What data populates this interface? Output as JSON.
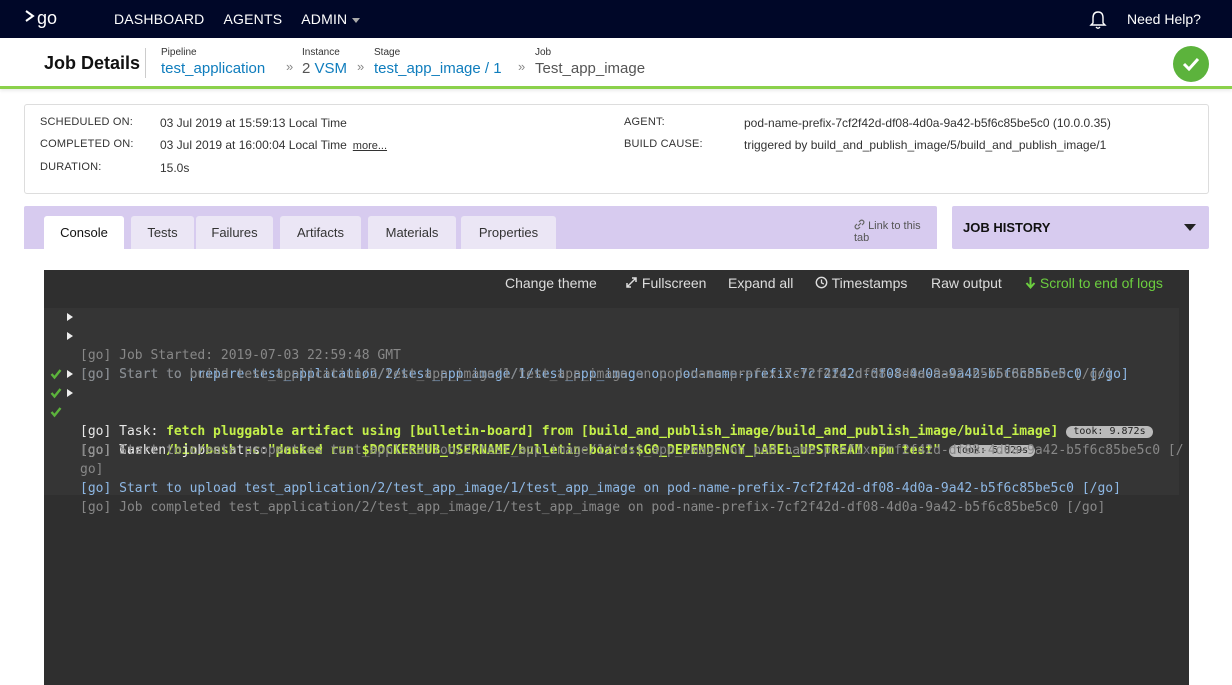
{
  "nav": {
    "logo_text": "go",
    "items": [
      "DASHBOARD",
      "AGENTS",
      "ADMIN"
    ],
    "help": "Need Help?",
    "background": "#000728"
  },
  "header": {
    "title": "Job Details",
    "pipeline_label": "Pipeline",
    "pipeline": "test_application",
    "instance_label": "Instance",
    "instance_num": "2",
    "instance_name": "VSM",
    "stage_label": "Stage",
    "stage": "test_app_image / 1",
    "job_label": "Job",
    "job": "Test_app_image",
    "status_icon": "check-icon",
    "status_color": "#5cb33c"
  },
  "info": {
    "scheduled_label": "SCHEDULED ON:",
    "scheduled": "03 Jul 2019 at 15:59:13 Local Time",
    "completed_label": "COMPLETED ON:",
    "completed": "03 Jul 2019 at 16:00:04 Local Time",
    "more": "more...",
    "duration_label": "DURATION:",
    "duration": "15.0s",
    "agent_label": "AGENT:",
    "agent": "pod-name-prefix-7cf2f42d-df08-4d0a-9a42-b5f6c85be5c0 (10.0.0.35)",
    "cause_label": "BUILD CAUSE:",
    "cause": "triggered by build_and_publish_image/5/build_and_publish_image/1"
  },
  "tabs": {
    "items": [
      "Console",
      "Tests",
      "Failures",
      "Artifacts",
      "Materials",
      "Properties"
    ],
    "active": "Console",
    "link": "Link to this tab"
  },
  "history": {
    "title": "JOB HISTORY"
  },
  "console": {
    "toolbar": {
      "theme": "Change theme",
      "fullscreen": "Fullscreen",
      "expand": "Expand all",
      "timestamps": "Timestamps",
      "raw": "Raw output",
      "scroll": "Scroll to end of logs"
    },
    "lines": {
      "l1": "[go] Job Started: 2019-07-03 22:59:48 GMT",
      "l2": "[go] Start to prepare test_application/2/test_app_image/1/test_app_image on pod-name-prefix-7cf2f42d-df08-4d0a-9a42-b5f6c85be5c0 [/go]",
      "l3": "[go] Start to build test_application/2/test_app_image/1/test_app_image on pod-name-prefix-7cf2f42d-df08-4d0a-9a42-b5f6c85be5c0 [/go]",
      "l4_prefix": "[go] Task: ",
      "l4_cmd": "fetch pluggable artifact using [bulletin-board] from [build_and_publish_image/build_and_publish_image/build_image]",
      "l4_took": "took: 9.872s",
      "l5_prefix": "[go] Task: ",
      "l5_cmd": "/bin/bash -c \"docker run $DOCKERHUB_USERNAME/bulletin-board:$GO_DEPENDENCY_LABEL_UPSTREAM npm test\"",
      "l5_took": "took: 5.829s",
      "l6_prefix": "[go] Current job status: ",
      "l6_status": "passed",
      "l7a": "[go] Start to create properties test_application/2/test_app_image/1/test_app_image on pod-name-prefix-7cf2f42d-df08-4d0a-9a42-b5f6c85be5c0 [/",
      "l7b": "go]",
      "l8": "[go] Start to upload test_application/2/test_app_image/1/test_app_image on pod-name-prefix-7cf2f42d-df08-4d0a-9a42-b5f6c85be5c0 [/go]",
      "l9": "[go] Job completed test_application/2/test_app_image/1/test_app_image on pod-name-prefix-7cf2f42d-df08-4d0a-9a42-b5f6c85be5c0 [/go]"
    }
  }
}
